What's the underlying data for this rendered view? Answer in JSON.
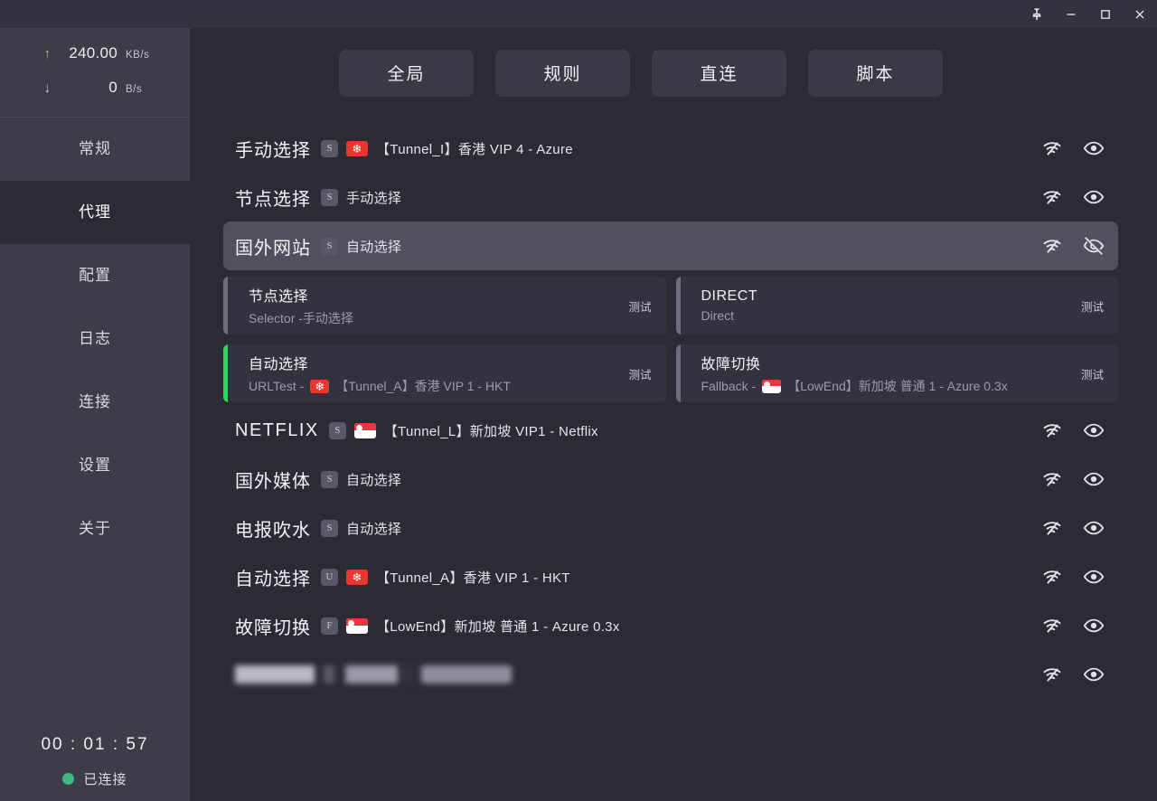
{
  "titlebar": {
    "buttons": [
      {
        "name": "pin-icon",
        "label": "Pin"
      },
      {
        "name": "minimize-icon",
        "label": "Minimize"
      },
      {
        "name": "maximize-icon",
        "label": "Maximize"
      },
      {
        "name": "close-icon",
        "label": "Close"
      }
    ]
  },
  "sidebar": {
    "speed": {
      "upload": {
        "arrow": "↑",
        "value": "240.00",
        "unit": "KB/s"
      },
      "download": {
        "arrow": "↓",
        "value": "0",
        "unit": "B/s"
      }
    },
    "items": [
      {
        "label": "常规",
        "active": false
      },
      {
        "label": "代理",
        "active": true
      },
      {
        "label": "配置",
        "active": false
      },
      {
        "label": "日志",
        "active": false
      },
      {
        "label": "连接",
        "active": false
      },
      {
        "label": "设置",
        "active": false
      },
      {
        "label": "关于",
        "active": false
      }
    ],
    "status": {
      "timer": "00 : 01 : 57",
      "connection": "已连接",
      "dot_color": "#42b883"
    }
  },
  "modes": [
    {
      "label": "全局"
    },
    {
      "label": "规则"
    },
    {
      "label": "直连"
    },
    {
      "label": "脚本"
    }
  ],
  "groups": [
    {
      "title": "手动选择",
      "badge": "S",
      "flag": "hk",
      "current": "【Tunnel_I】香港 VIP 4 - Azure",
      "expanded": false,
      "eye": "eye",
      "latin": false
    },
    {
      "title": "节点选择",
      "badge": "S",
      "flag": "",
      "current": "手动选择",
      "expanded": false,
      "eye": "eye",
      "latin": false
    },
    {
      "title": "国外网站",
      "badge": "S",
      "flag": "",
      "current": "自动选择",
      "expanded": true,
      "eye": "eye-off",
      "latin": false,
      "nodes": [
        {
          "title": "节点选择",
          "type": "Selector",
          "detail": "手动选择",
          "flag": "",
          "selected": false,
          "test": "测试"
        },
        {
          "title": "DIRECT",
          "type": "Direct",
          "detail": "",
          "flag": "",
          "selected": false,
          "test": "测试"
        },
        {
          "title": "自动选择",
          "type": "URLTest",
          "detail": "【Tunnel_A】香港 VIP 1 - HKT",
          "flag": "hk",
          "selected": true,
          "test": "测试"
        },
        {
          "title": "故障切换",
          "type": "Fallback",
          "detail": "【LowEnd】新加坡 普通 1 - Azure 0.3x",
          "flag": "sg",
          "selected": false,
          "test": "测试"
        }
      ]
    },
    {
      "title": "NETFLIX",
      "badge": "S",
      "flag": "sg",
      "current": "【Tunnel_L】新加坡 VIP1 - Netflix",
      "expanded": false,
      "eye": "eye",
      "latin": true
    },
    {
      "title": "国外媒体",
      "badge": "S",
      "flag": "",
      "current": "自动选择",
      "expanded": false,
      "eye": "eye",
      "latin": false
    },
    {
      "title": "电报吹水",
      "badge": "S",
      "flag": "",
      "current": "自动选择",
      "expanded": false,
      "eye": "eye",
      "latin": false
    },
    {
      "title": "自动选择",
      "badge": "U",
      "flag": "hk",
      "current": "【Tunnel_A】香港 VIP 1 - HKT",
      "expanded": false,
      "eye": "eye",
      "latin": false
    },
    {
      "title": "故障切换",
      "badge": "F",
      "flag": "sg",
      "current": "【LowEnd】新加坡 普通 1 - Azure 0.3x",
      "expanded": false,
      "eye": "eye",
      "latin": false
    },
    {
      "title": "",
      "badge": "",
      "flag": "",
      "current": "",
      "expanded": false,
      "eye": "eye",
      "censored": true,
      "latin": false
    }
  ],
  "colors": {
    "background": "#2b2b36",
    "sidebar": "#3d3d4a",
    "titlebar": "#33333f",
    "highlight": "#50505f",
    "card": "#33333f",
    "selected_accent": "#2fd45e",
    "connected": "#42b883",
    "upload_arrow": "#d5b35e"
  }
}
